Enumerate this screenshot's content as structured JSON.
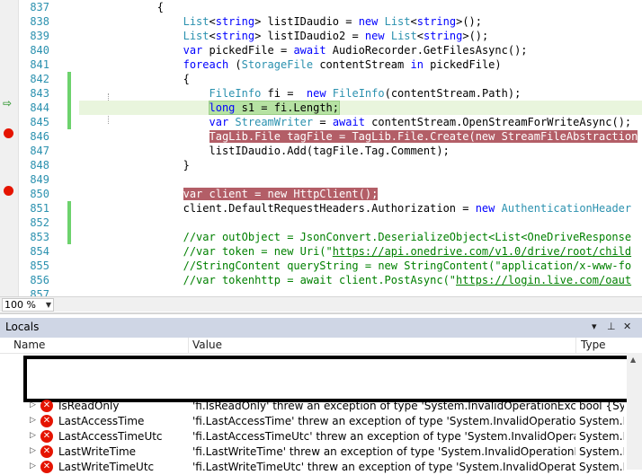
{
  "editor": {
    "lines": [
      {
        "num": "837",
        "tokens": [
          {
            "t": "            {",
            "c": ""
          }
        ]
      },
      {
        "num": "838",
        "tokens": [
          {
            "t": "                ",
            "c": ""
          },
          {
            "t": "List",
            "c": "ty"
          },
          {
            "t": "<",
            "c": ""
          },
          {
            "t": "string",
            "c": "kw"
          },
          {
            "t": "> listIDaudio = ",
            "c": ""
          },
          {
            "t": "new",
            "c": "kw"
          },
          {
            "t": " ",
            "c": ""
          },
          {
            "t": "List",
            "c": "ty"
          },
          {
            "t": "<",
            "c": ""
          },
          {
            "t": "string",
            "c": "kw"
          },
          {
            "t": ">();",
            "c": ""
          }
        ]
      },
      {
        "num": "839",
        "tokens": [
          {
            "t": "                ",
            "c": ""
          },
          {
            "t": "List",
            "c": "ty"
          },
          {
            "t": "<",
            "c": ""
          },
          {
            "t": "string",
            "c": "kw"
          },
          {
            "t": "> listIDaudio2 = ",
            "c": ""
          },
          {
            "t": "new",
            "c": "kw"
          },
          {
            "t": " ",
            "c": ""
          },
          {
            "t": "List",
            "c": "ty"
          },
          {
            "t": "<",
            "c": ""
          },
          {
            "t": "string",
            "c": "kw"
          },
          {
            "t": ">();",
            "c": ""
          }
        ]
      },
      {
        "num": "840",
        "tokens": [
          {
            "t": "                ",
            "c": ""
          },
          {
            "t": "var",
            "c": "kw"
          },
          {
            "t": " pickedFile = ",
            "c": ""
          },
          {
            "t": "await",
            "c": "kw"
          },
          {
            "t": " AudioRecorder.GetFilesAsync();",
            "c": ""
          }
        ]
      },
      {
        "num": "841",
        "tokens": [
          {
            "t": "                ",
            "c": ""
          },
          {
            "t": "foreach",
            "c": "kw"
          },
          {
            "t": " (",
            "c": ""
          },
          {
            "t": "StorageFile",
            "c": "ty"
          },
          {
            "t": " contentStream ",
            "c": ""
          },
          {
            "t": "in",
            "c": "kw"
          },
          {
            "t": " pickedFile)",
            "c": ""
          }
        ]
      },
      {
        "num": "842",
        "tokens": [
          {
            "t": "                {",
            "c": ""
          }
        ]
      },
      {
        "num": "843",
        "tokens": [
          {
            "t": "                    ",
            "c": ""
          },
          {
            "t": "FileInfo",
            "c": "ty"
          },
          {
            "t": " fi =  ",
            "c": ""
          },
          {
            "t": "new",
            "c": "kw"
          },
          {
            "t": " ",
            "c": ""
          },
          {
            "t": "FileInfo",
            "c": "ty"
          },
          {
            "t": "(contentStream.Path);",
            "c": ""
          }
        ]
      },
      {
        "num": "844",
        "hl": "cur",
        "tokens": [
          {
            "t": "                    ",
            "c": ""
          },
          {
            "t": "long",
            "c": "kw"
          },
          {
            "t": " s1 = fi.Length;",
            "c": ""
          }
        ]
      },
      {
        "num": "845",
        "tokens": [
          {
            "t": "                    ",
            "c": ""
          },
          {
            "t": "var",
            "c": "kw"
          },
          {
            "t": " ",
            "c": ""
          },
          {
            "t": "StreamWriter",
            "c": "ty"
          },
          {
            "t": " = ",
            "c": ""
          },
          {
            "t": "await",
            "c": "kw"
          },
          {
            "t": " contentStream.OpenStreamForWriteAsync();",
            "c": ""
          }
        ]
      },
      {
        "num": "846",
        "hl": "bp",
        "tokens": [
          {
            "t": "                    ",
            "c": ""
          },
          {
            "t": "TagLib.File tagFile = TagLib.File.Create(new StreamFileAbstraction",
            "c": ""
          }
        ]
      },
      {
        "num": "847",
        "tokens": [
          {
            "t": "                    listIDaudio.Add(tagFile.Tag.Comment);",
            "c": ""
          }
        ]
      },
      {
        "num": "848",
        "tokens": [
          {
            "t": "                }",
            "c": ""
          }
        ]
      },
      {
        "num": "849",
        "tokens": [
          {
            "t": "",
            "c": ""
          }
        ]
      },
      {
        "num": "850",
        "hl": "bp",
        "tokens": [
          {
            "t": "                ",
            "c": ""
          },
          {
            "t": "var client = new HttpClient();",
            "c": ""
          }
        ]
      },
      {
        "num": "851",
        "tokens": [
          {
            "t": "                client.DefaultRequestHeaders.Authorization = ",
            "c": ""
          },
          {
            "t": "new",
            "c": "kw"
          },
          {
            "t": " ",
            "c": ""
          },
          {
            "t": "AuthenticationHeader",
            "c": "ty"
          }
        ]
      },
      {
        "num": "852",
        "tokens": [
          {
            "t": "",
            "c": ""
          }
        ]
      },
      {
        "num": "853",
        "tokens": [
          {
            "t": "                ",
            "c": ""
          },
          {
            "t": "//var outObject = JsonConvert.DeserializeObject<List<OneDriveResponse",
            "c": "cm"
          }
        ]
      },
      {
        "num": "854",
        "tokens": [
          {
            "t": "                ",
            "c": ""
          },
          {
            "t": "//var token = new Uri(\"",
            "c": "cm"
          },
          {
            "t": "https://api.onedrive.com/v1.0/drive/root/child",
            "c": "cm-link"
          }
        ]
      },
      {
        "num": "855",
        "tokens": [
          {
            "t": "                ",
            "c": ""
          },
          {
            "t": "//StringContent queryString = new StringContent(\"application/x-www-fo",
            "c": "cm"
          }
        ]
      },
      {
        "num": "856",
        "tokens": [
          {
            "t": "                ",
            "c": ""
          },
          {
            "t": "//var tokenhttp = await client.PostAsync(\"",
            "c": "cm"
          },
          {
            "t": "https://login.live.com/oaut",
            "c": "cm-link"
          }
        ]
      },
      {
        "num": "857",
        "tokens": [
          {
            "t": "",
            "c": ""
          }
        ]
      }
    ]
  },
  "zoom": {
    "value": "100 %"
  },
  "locals": {
    "title": "Locals",
    "pin_icon": "pin-icon",
    "dropdown_icon": "dropdown-arrow-icon",
    "close_icon": "close-icon",
    "columns": {
      "name": "Name",
      "value": "Value",
      "type": "Type"
    },
    "rows": [
      {
        "name": "IsReadOnly",
        "value": "'fi.IsReadOnly' threw an exception of type 'System.InvalidOperationException'",
        "type": "bool {Sys"
      },
      {
        "name": "LastAccessTime",
        "value": "'fi.LastAccessTime' threw an exception of type 'System.InvalidOperationException'",
        "type": "System.D"
      },
      {
        "name": "LastAccessTimeUtc",
        "value": "'fi.LastAccessTimeUtc' threw an exception of type 'System.InvalidOperationException'",
        "type": "System.D"
      },
      {
        "name": "LastWriteTime",
        "value": "'fi.LastWriteTime' threw an exception of type 'System.InvalidOperationException'",
        "type": "System.D"
      },
      {
        "name": "LastWriteTimeUtc",
        "value": "'fi.LastWriteTimeUtc' threw an exception of type 'System.InvalidOperationException'",
        "type": "System.D"
      }
    ]
  },
  "colors": {
    "breakpoint": "#e51400",
    "breakpoint_line": "#b35e67",
    "current_line": "#b6e2a3",
    "keyword": "#0000ff",
    "type": "#2b91af",
    "comment": "#008000"
  }
}
